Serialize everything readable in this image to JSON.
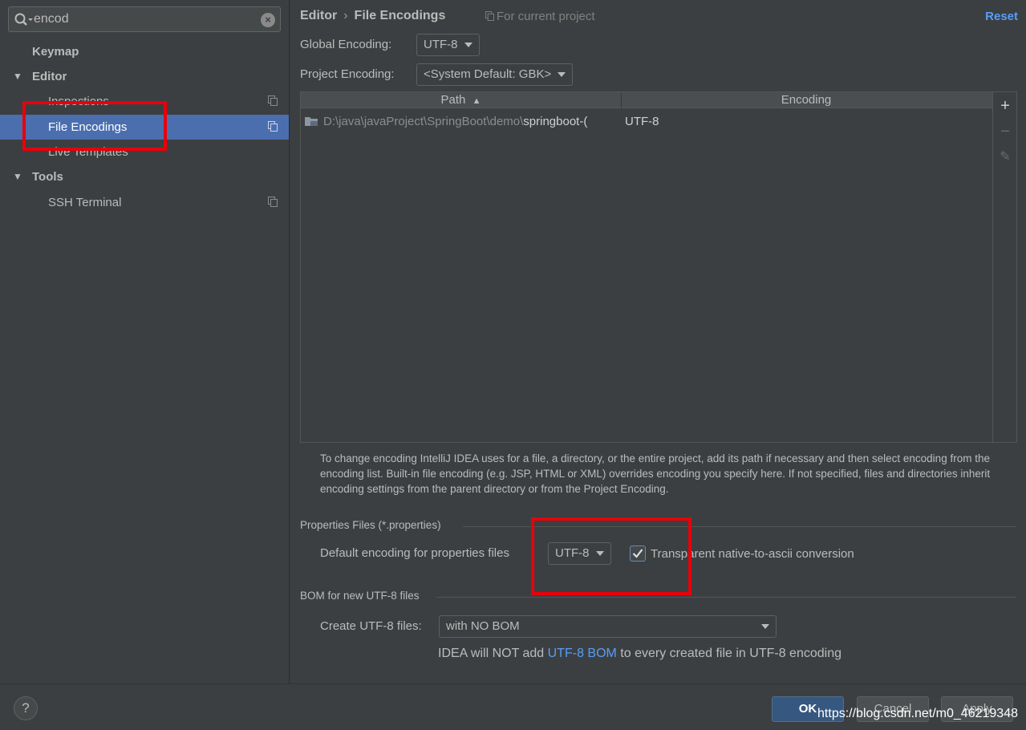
{
  "search": {
    "value": "encod",
    "icon": "search-icon",
    "clear_icon": "clear-icon"
  },
  "sidebar": {
    "items": [
      {
        "label": "Keymap",
        "level": 0,
        "bold": true
      },
      {
        "label": "Editor",
        "level": 0,
        "bold": true,
        "expanded": true
      },
      {
        "label": "Inspections",
        "level": 1
      },
      {
        "label": "File Encodings",
        "level": 1,
        "selected": true
      },
      {
        "label": "Live Templates",
        "level": 1
      },
      {
        "label": "Tools",
        "level": 0,
        "bold": true,
        "expanded": true
      },
      {
        "label": "SSH Terminal",
        "level": 1
      }
    ]
  },
  "header": {
    "crumb_parent": "Editor",
    "crumb_separator": "›",
    "crumb_current": "File Encodings",
    "for_project": "For current project",
    "reset": "Reset"
  },
  "global_encoding": {
    "label": "Global Encoding:",
    "value": "UTF-8"
  },
  "project_encoding": {
    "label": "Project Encoding:",
    "value": "<System Default: GBK>"
  },
  "table": {
    "columns": [
      "Path",
      "Encoding"
    ],
    "sort_indicator": "▲",
    "rows": [
      {
        "path_dim": "D:\\java\\javaProject\\SpringBoot\\demo\\",
        "path_bright": "springboot-(",
        "encoding": "UTF-8"
      }
    ],
    "tools": {
      "add": "+",
      "remove": "−",
      "edit": "✎"
    }
  },
  "help_text": "To change encoding IntelliJ IDEA uses for a file, a directory, or the entire project, add its path if necessary and then select encoding from the encoding list. Built-in file encoding (e.g. JSP, HTML or XML) overrides encoding you specify here. If not specified, files and directories inherit encoding settings from the parent directory or from the Project Encoding.",
  "properties": {
    "section": "Properties Files (*.properties)",
    "label": "Default encoding for properties files",
    "value": "UTF-8",
    "checkbox_label": "Transparent native-to-ascii conversion",
    "checked": true
  },
  "bom": {
    "section": "BOM for new UTF-8 files",
    "label": "Create UTF-8 files:",
    "value": "with NO BOM",
    "note_before": "IDEA will NOT add ",
    "note_link": "UTF-8 BOM",
    "note_after": " to every created file in UTF-8 encoding"
  },
  "footer": {
    "help": "?",
    "ok": "OK",
    "cancel": "Cancel",
    "apply": "Apply",
    "watermark": "https://blog.csdn.net/m0_46219348"
  },
  "colors": {
    "accent": "#4b6eaf",
    "link": "#589df6",
    "highlight_box": "#e8000b",
    "background": "#3c3f41"
  }
}
